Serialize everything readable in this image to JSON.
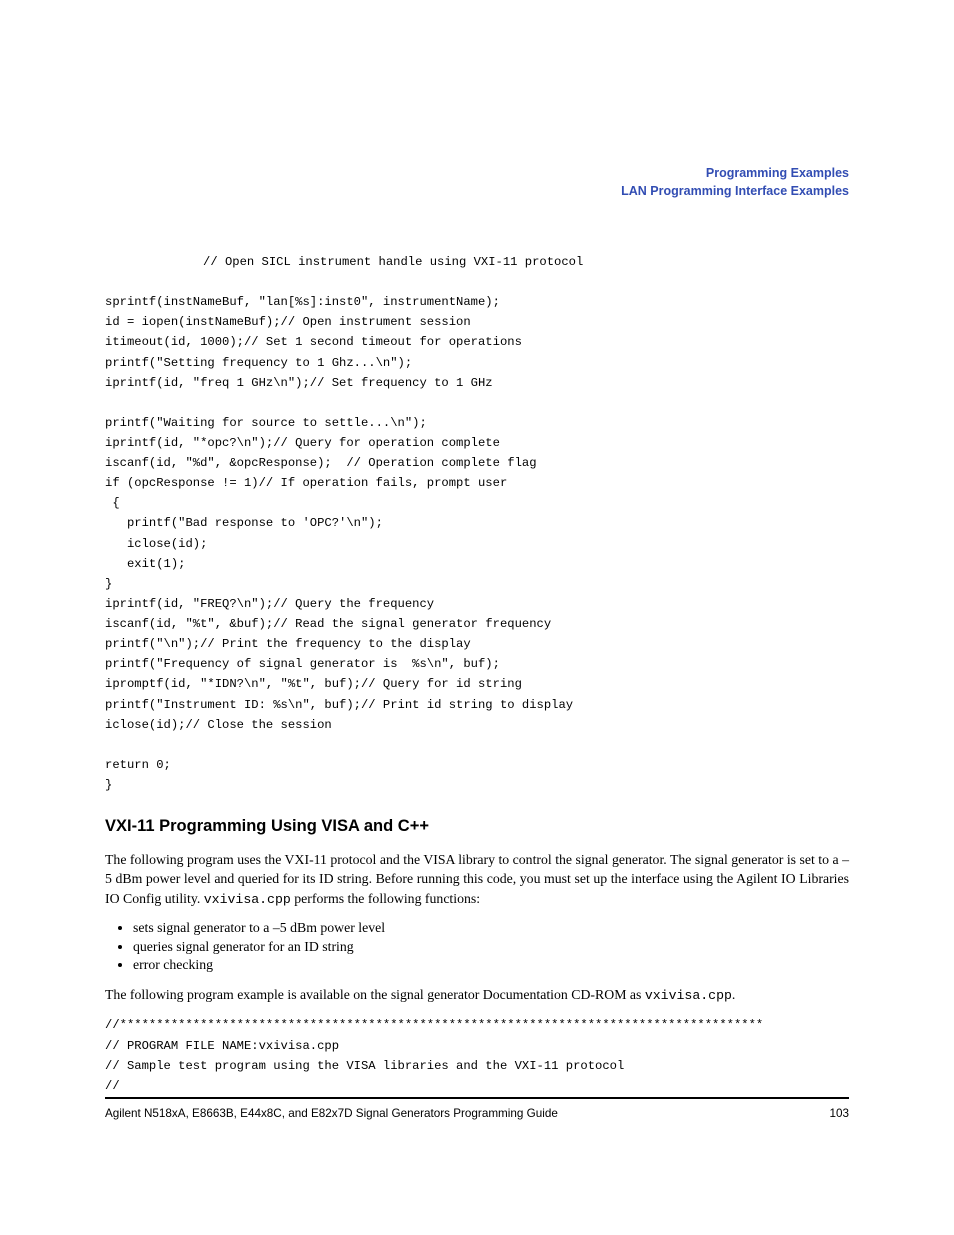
{
  "header": {
    "line1": "Programming Examples",
    "line2": "LAN Programming Interface Examples"
  },
  "code1": {
    "comment": "// Open SICL instrument handle using VXI-11 protocol",
    "l1": "sprintf(instNameBuf, \"lan[%s]:inst0\", instrumentName);",
    "l2": "id = iopen(instNameBuf);// Open instrument session",
    "l3": "itimeout(id, 1000);// Set 1 second timeout for operations",
    "l4": "printf(\"Setting frequency to 1 Ghz...\\n\");",
    "l5": "iprintf(id, \"freq 1 GHz\\n\");// Set frequency to 1 GHz",
    "l6": "printf(\"Waiting for source to settle...\\n\");",
    "l7": "iprintf(id, \"*opc?\\n\");// Query for operation complete",
    "l8": "iscanf(id, \"%d\", &opcResponse);  // Operation complete flag",
    "l9": "if (opcResponse != 1)// If operation fails, prompt user",
    "l10": " {",
    "l11": "   printf(\"Bad response to 'OPC?'\\n\");",
    "l12": "   iclose(id);",
    "l13": "   exit(1);",
    "l14": "}",
    "l15": "iprintf(id, \"FREQ?\\n\");// Query the frequency",
    "l16": "iscanf(id, \"%t\", &buf);// Read the signal generator frequency",
    "l17": "printf(\"\\n\");// Print the frequency to the display",
    "l18": "printf(\"Frequency of signal generator is  %s\\n\", buf);",
    "l19": "ipromptf(id, \"*IDN?\\n\", \"%t\", buf);// Query for id string",
    "l20": "printf(\"Instrument ID: %s\\n\", buf);// Print id string to display",
    "l21": "iclose(id);// Close the session",
    "l22": "return 0;",
    "l23": "}"
  },
  "heading": "VXI-11 Programming Using VISA and C++",
  "para1": {
    "pre": "The following program uses the VXI-11 protocol and the VISA library to control the signal generator. The signal generator is set to a –5 dBm power level and queried for its ID string. Before running this code, you must set up the interface using the Agilent IO Libraries IO Config utility. ",
    "monopart": "vxivisa.cpp",
    "post": " performs the following functions:"
  },
  "bullets": {
    "b1": "sets signal generator to a –5 dBm power level",
    "b2": "queries signal generator for an ID string",
    "b3": "error checking"
  },
  "para2": {
    "pre": "The following program example is available on the signal generator Documentation CD-ROM as ",
    "monopart": "vxivisa.cpp",
    "post": "."
  },
  "code2": {
    "l1": "//****************************************************************************************",
    "l2": "// PROGRAM FILE NAME:vxivisa.cpp",
    "l3": "// Sample test program using the VISA libraries and the VXI-11 protocol",
    "l4": "// "
  },
  "footer": {
    "left": "Agilent N518xA, E8663B, E44x8C, and E82x7D Signal Generators Programming Guide",
    "right": "103"
  }
}
